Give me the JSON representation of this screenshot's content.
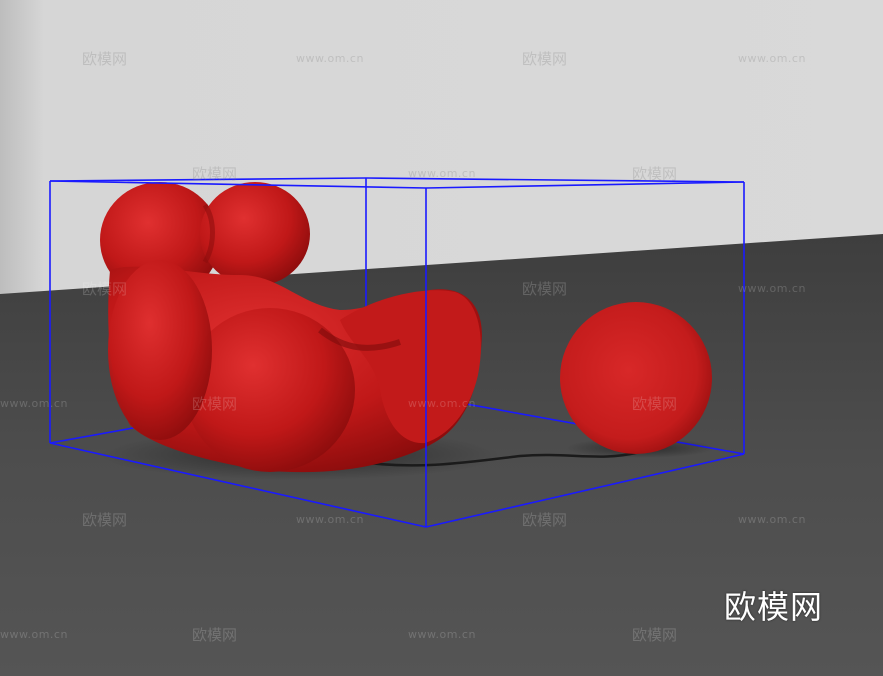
{
  "logo": {
    "text": "欧模网"
  },
  "watermark": {
    "brand": "欧模网",
    "url": "www.om.cn"
  },
  "colors": {
    "wall": "#d7d7d7",
    "floor": "#4b4b4b",
    "bounding_box": "#1a1aff",
    "chair": "#c41a1a",
    "ball": "#c81c1c"
  },
  "objects": {
    "chair": "red-blob-armchair",
    "ottoman": "red-sphere-ottoman",
    "cord": "black-cord",
    "selection": "blue-bounding-box"
  }
}
